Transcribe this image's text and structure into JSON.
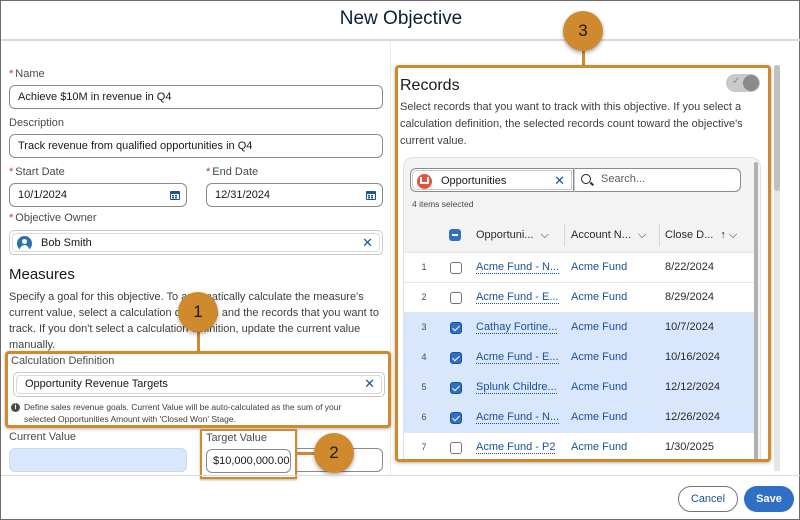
{
  "dialog": {
    "title": "New Objective"
  },
  "form": {
    "name": {
      "label": "Name",
      "required": true,
      "value": "Achieve $10M in revenue in Q4"
    },
    "description": {
      "label": "Description",
      "value": "Track revenue from qualified opportunities in Q4"
    },
    "start_date": {
      "label": "Start Date",
      "required": true,
      "value": "10/1/2024",
      "icon": "calendar-icon"
    },
    "end_date": {
      "label": "End Date",
      "required": true,
      "value": "12/31/2024",
      "icon": "calendar-icon"
    },
    "owner": {
      "label": "Objective Owner",
      "required": true,
      "value": "Bob Smith",
      "icon": "user-avatar-icon"
    }
  },
  "measures": {
    "heading": "Measures",
    "text_line1": "Specify a goal for this objective. To automatically calculate the measure's",
    "text_line2": "current value, select a calculation definition and the records that you want to",
    "text_line3": "track. If you don't select a calculation definition, update the current value",
    "text_line4": "manually.",
    "calc_definition": {
      "label": "Calculation Definition",
      "value": "Opportunity Revenue Targets",
      "help_line1": "Define sales revenue goals. Current Value will be auto-calculated as the sum of your",
      "help_line2": "selected Opportunities Amount with 'Closed Won' Stage."
    },
    "current_value": {
      "label": "Current Value",
      "value": ""
    },
    "target_value": {
      "label": "Target Value",
      "value": "$10,000,000.00"
    }
  },
  "records": {
    "heading": "Records",
    "toggle_on": false,
    "text_line1": "Select records that you want to track with this objective. If you select a",
    "text_line2": "calculation definition, the selected records count toward the objective's",
    "text_line3": "current value.",
    "object_selector": "Opportunities",
    "search_placeholder": "Search...",
    "selected_count": "4 items selected",
    "columns": [
      "Opportuni...",
      "Account N...",
      "Close D..."
    ],
    "rows": [
      {
        "num": "1",
        "checked": false,
        "opportunity": "Acme Fund - N...",
        "account": "Acme Fund",
        "close_date": "8/22/2024"
      },
      {
        "num": "2",
        "checked": false,
        "opportunity": "Acme Fund - E...",
        "account": "Acme Fund",
        "close_date": "8/29/2024"
      },
      {
        "num": "3",
        "checked": true,
        "opportunity": "Cathay Fortine...",
        "account": "Acme Fund",
        "close_date": "10/7/2024"
      },
      {
        "num": "4",
        "checked": true,
        "opportunity": "Acme Fund - E...",
        "account": "Acme Fund",
        "close_date": "10/16/2024"
      },
      {
        "num": "5",
        "checked": true,
        "opportunity": "Splunk Childre...",
        "account": "Acme Fund",
        "close_date": "12/12/2024"
      },
      {
        "num": "6",
        "checked": true,
        "opportunity": "Acme Fund - N...",
        "account": "Acme Fund",
        "close_date": "12/26/2024"
      },
      {
        "num": "7",
        "checked": false,
        "opportunity": "Acme Fund - P2",
        "account": "Acme Fund",
        "close_date": "1/30/2025"
      }
    ]
  },
  "callouts": [
    "1",
    "2",
    "3"
  ],
  "footer": {
    "cancel_label": "Cancel",
    "save_label": "Save"
  },
  "colors": {
    "accent": "#2f6fc4",
    "callout": "#d08a2e",
    "selected_row": "#d8e6fe",
    "required": "#c23934"
  }
}
